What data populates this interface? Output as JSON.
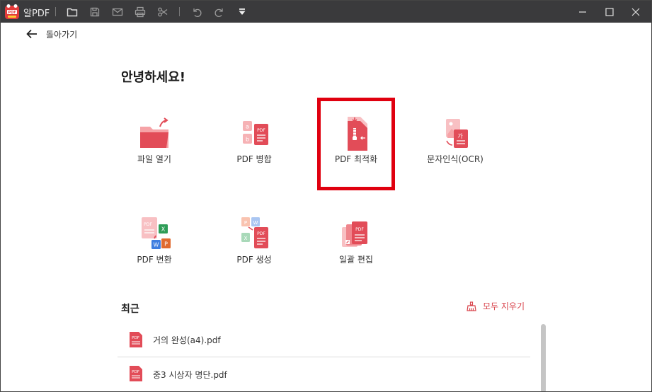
{
  "titlebar": {
    "app_name": "알PDF",
    "toolbar": [
      "open-folder-icon",
      "save-icon",
      "mail-icon",
      "print-icon",
      "scissors-icon",
      "undo-icon",
      "redo-icon",
      "dropdown-arrow-icon"
    ],
    "window_controls": [
      "minimize-icon",
      "maximize-icon",
      "close-icon"
    ]
  },
  "nav": {
    "back_label": "돌아가기"
  },
  "greeting": "안녕하세요!",
  "tools": [
    {
      "label": "파일 열기",
      "icon": "folder-open-icon"
    },
    {
      "label": "PDF 병합",
      "icon": "pdf-merge-icon"
    },
    {
      "label": "PDF 최적화",
      "icon": "pdf-compress-icon"
    },
    {
      "label": "문자인식(OCR)",
      "icon": "ocr-icon"
    },
    {
      "label": "PDF 변환",
      "icon": "pdf-convert-icon"
    },
    {
      "label": "PDF 생성",
      "icon": "pdf-create-icon"
    },
    {
      "label": "일괄 편집",
      "icon": "batch-edit-icon"
    }
  ],
  "recent": {
    "title": "최근",
    "clear_label": "모두 지우기",
    "files": [
      {
        "name": "거의 완성(a4).pdf"
      },
      {
        "name": "중3 시상자 명단.pdf"
      }
    ]
  },
  "colors": {
    "titlebar_bg": "#3a3a3c",
    "accent_red": "#e04a55",
    "highlight_border": "#e0000f"
  }
}
